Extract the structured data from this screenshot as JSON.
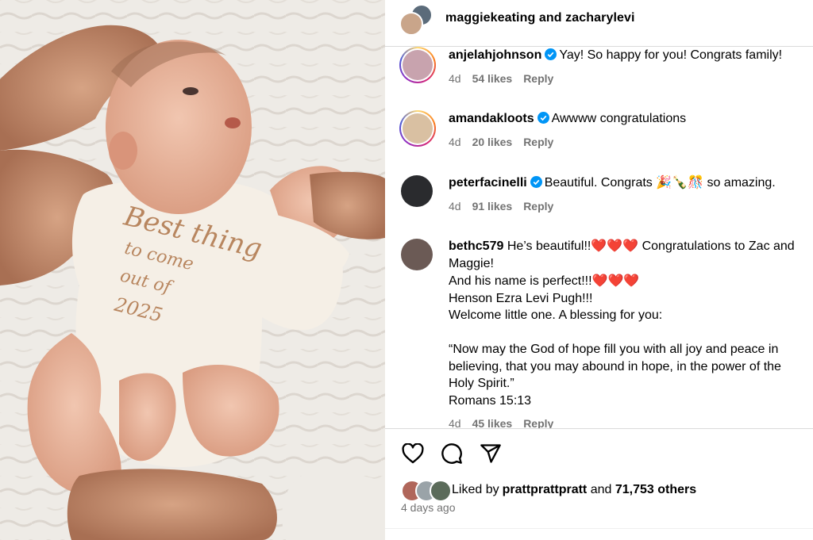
{
  "post": {
    "photo_alt": "Newborn baby in onesie",
    "onesie_text": [
      "Best thing",
      "to come",
      "out of",
      "2025"
    ]
  },
  "header": {
    "title": "maggiekeating and zacharylevi"
  },
  "comments": [
    {
      "username": "anjelahjohnson",
      "verified": true,
      "text": "Yay! So happy for you! Congrats family!",
      "time": "4d",
      "likes": "54 likes",
      "reply": "Reply",
      "avatar_color": "#c8a3ae"
    },
    {
      "username": "amandakloots",
      "verified": true,
      "text": "Awwww congratulations",
      "time": "4d",
      "likes": "20 likes",
      "reply": "Reply",
      "avatar_color": "#d9c0a2"
    },
    {
      "username": "peterfacinelli",
      "verified": true,
      "text_before": "Beautiful. Congrats ",
      "emojis": "🎉🍾🎊",
      "text_after": " so amazing.",
      "time": "4d",
      "likes": "91 likes",
      "reply": "Reply",
      "avatar_color": "#2a2b2e"
    },
    {
      "username": "bethc579",
      "verified": false,
      "line1_before": " He’s beautiful!!",
      "line1_hearts": "❤️❤️❤️",
      "line1_after": " Congratulations to Zac and",
      "line2": "Maggie!",
      "line3_before": "And his name is perfect!!!",
      "line3_hearts": "❤️❤️❤️",
      "line4": "Henson Ezra Levi Pugh!!!",
      "line5": "Welcome little one. A blessing for you:",
      "line6": "“Now may the God of hope fill you with all joy and peace in",
      "line7": "believing, that you may abound in hope, in the power of the",
      "line8": "Holy Spirit.”",
      "line9": "Romans 15:13",
      "time": "4d",
      "likes": "45 likes",
      "reply": "Reply",
      "avatar_color": "#6b5a55"
    }
  ],
  "actions": {
    "like_icon": "heart-icon",
    "comment_icon": "comment-icon",
    "share_icon": "share-icon"
  },
  "likes": {
    "prefix": "Liked by ",
    "user": "prattprattpratt",
    "middle": " and ",
    "others": "71,753 others"
  },
  "posted": "4 days ago",
  "colors": {
    "verified": "#0095f6",
    "meta_gray": "#737373",
    "divider": "#dbdbdb"
  }
}
